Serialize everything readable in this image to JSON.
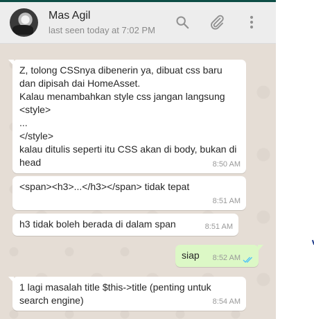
{
  "header": {
    "contact_name": "Mas Agil",
    "status": "last seen today at 7:02 PM",
    "icons": [
      "search-icon",
      "attach-icon",
      "menu-icon"
    ]
  },
  "messages": [
    {
      "direction": "incoming",
      "text": "Z, tolong CSSnya dibenerin ya, dibuat css baru dan dipisah dai HomeAsset.\nKalau menambahkan style css jangan langsung <style>\n...\n</style>\nkalau ditulis seperti itu CSS akan di body, bukan di head",
      "time": "8:50 AM"
    },
    {
      "direction": "incoming",
      "text": "<span><h3>...</h3></span> tidak tepat",
      "time": "8:51 AM"
    },
    {
      "direction": "incoming",
      "text": "h3 tidak boleh berada di dalam span",
      "time": "8:51 AM"
    },
    {
      "direction": "outgoing",
      "text": "siap",
      "time": "8:52 AM",
      "status_icon": "double-check-read-icon"
    },
    {
      "direction": "incoming",
      "text": "1 lagi masalah title $this->title (penting untuk search engine)",
      "time": "8:54 AM"
    }
  ],
  "colors": {
    "header_bg": "#ededed",
    "chat_bg": "#e5ddd5",
    "incoming_bubble": "#ffffff",
    "outgoing_bubble": "#dcf8c6",
    "read_ticks": "#4fc3f7",
    "icon_gray": "#919191"
  }
}
